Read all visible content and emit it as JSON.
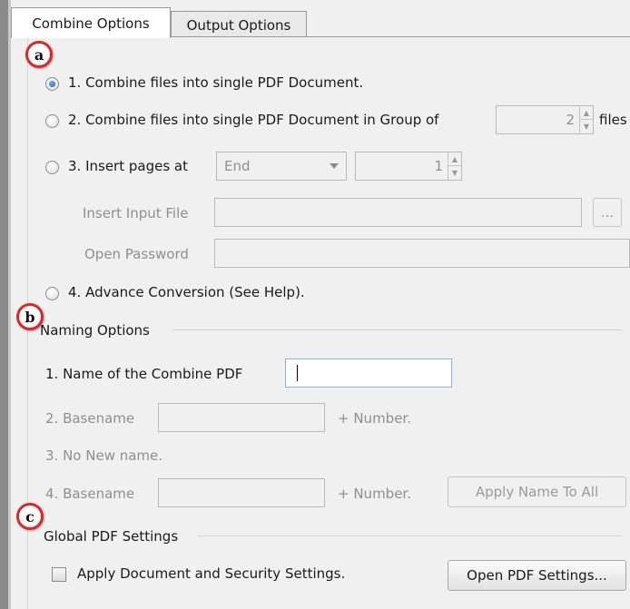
{
  "tabs": [
    "Combine Options",
    "Output Options"
  ],
  "badges": {
    "a": "a",
    "b": "b",
    "c": "c"
  },
  "combine": {
    "opt1": "1. Combine files into single PDF Document.",
    "opt2": "2. Combine files into single PDF Document in Group of",
    "opt2_value": "2",
    "opt2_suffix": "files",
    "opt3": "3. Insert pages at",
    "opt3_position": "End",
    "opt3_value": "1",
    "insert_input_label": "Insert Input File",
    "browse_label": "...",
    "open_password_label": "Open Password",
    "opt4": "4. Advance Conversion (See Help)."
  },
  "naming": {
    "title": "Naming Options",
    "name_label": "1. Name of the Combine PDF",
    "name_value": "",
    "basename_label": "2. Basename",
    "plus_number": "+ Number.",
    "no_new_name": "3. No New name.",
    "basename4_label": "4. Basename",
    "plus_number4": "+ Number.",
    "apply_button": "Apply Name To All"
  },
  "global": {
    "title": "Global PDF Settings",
    "apply_settings": "Apply Document and Security Settings.",
    "open_settings_button": "Open PDF Settings..."
  }
}
